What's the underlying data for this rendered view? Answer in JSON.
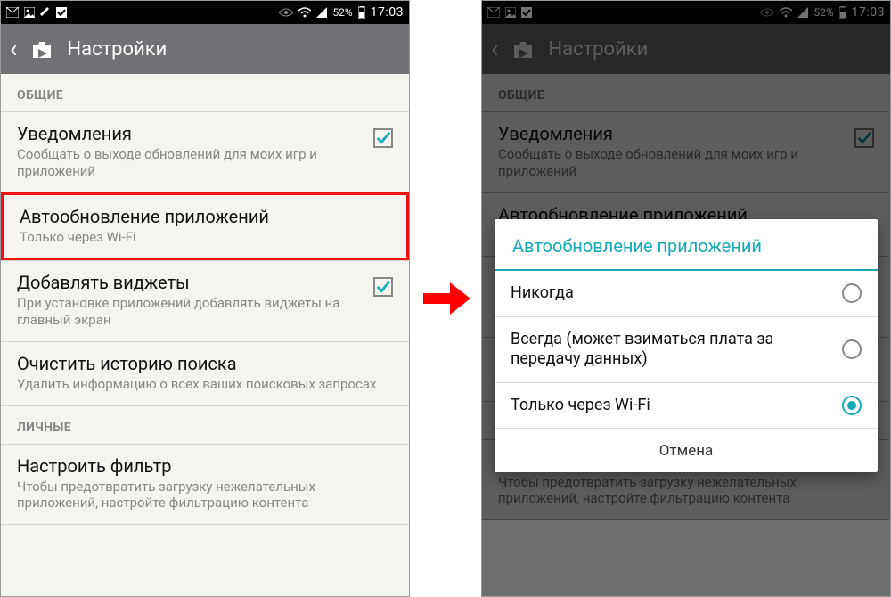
{
  "statusbar": {
    "battery_pct": "52%",
    "time": "17:03"
  },
  "appbar": {
    "title": "Настройки"
  },
  "sections": {
    "general_label": "ОБЩИЕ",
    "personal_label": "ЛИЧНЫЕ"
  },
  "rows": {
    "notifications": {
      "title": "Уведомления",
      "sub": "Сообщать о выходе обновлений для моих игр и приложений"
    },
    "autoupdate": {
      "title": "Автообновление приложений",
      "sub": "Только через Wi-Fi"
    },
    "widgets": {
      "title": "Добавлять виджеты",
      "sub": "При установке приложений добавлять виджеты на главный экран"
    },
    "clear_history": {
      "title": "Очистить историю поиска",
      "sub": "Удалить информацию о всех ваших поисковых запросах"
    },
    "filter": {
      "title": "Настроить фильтр",
      "sub": "Чтобы предотвратить загрузку нежелательных приложений, настройте фильтрацию контента"
    }
  },
  "dialog": {
    "title": "Автообновление приложений",
    "option_never": "Никогда",
    "option_always": "Всегда (может взиматься плата за передачу данных)",
    "option_wifi": "Только через Wi-Fi",
    "cancel": "Отмена"
  }
}
